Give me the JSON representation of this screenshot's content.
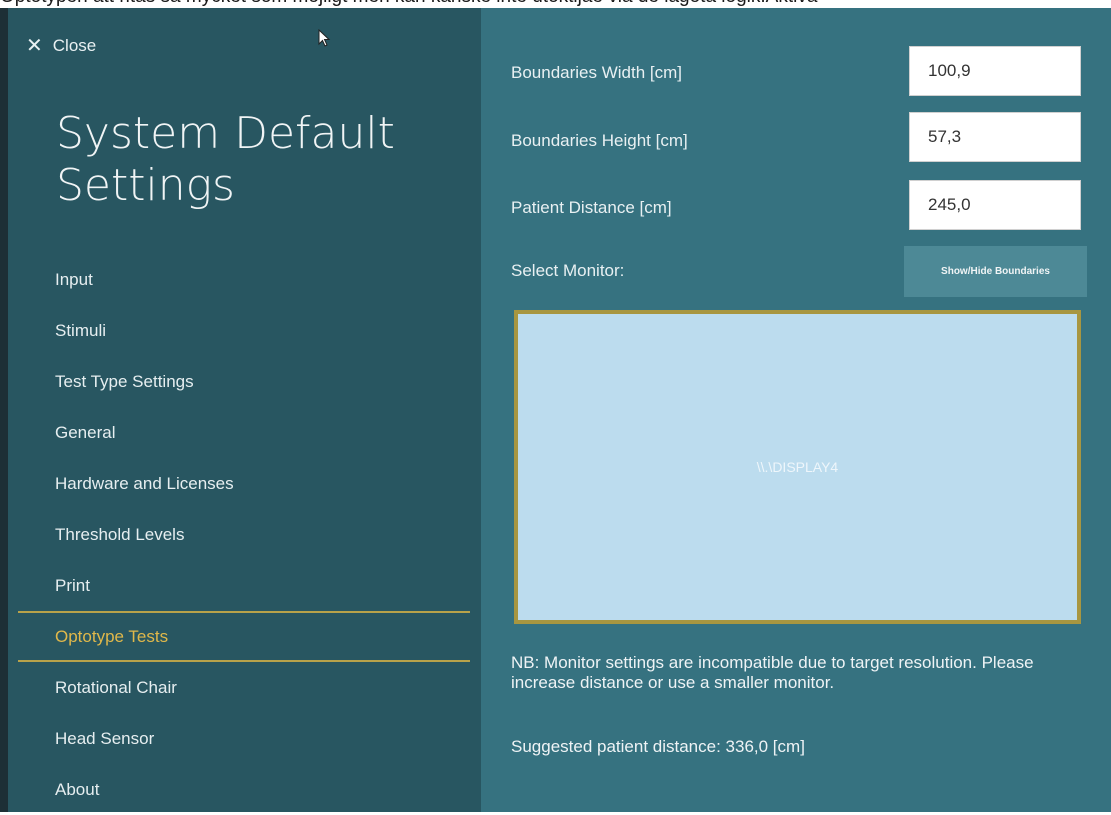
{
  "top_caption": "Optotypen att ritas så mycket som möjligt men kan kanske inte utöktijae via de lagota logik.Aktiva",
  "sidebar": {
    "close_label": "Close",
    "title": "System Default Settings",
    "items": [
      {
        "label": "Input",
        "active": false
      },
      {
        "label": "Stimuli",
        "active": false
      },
      {
        "label": "Test Type Settings",
        "active": false
      },
      {
        "label": "General",
        "active": false
      },
      {
        "label": "Hardware and Licenses",
        "active": false
      },
      {
        "label": "Threshold Levels",
        "active": false
      },
      {
        "label": "Print",
        "active": false
      },
      {
        "label": "Optotype Tests",
        "active": true
      },
      {
        "label": "Rotational Chair",
        "active": false
      },
      {
        "label": "Head Sensor",
        "active": false
      },
      {
        "label": "About",
        "active": false
      }
    ]
  },
  "main": {
    "fields": [
      {
        "label": "Boundaries Width  [cm]",
        "value": "100,9"
      },
      {
        "label": "Boundaries Height  [cm]",
        "value": "57,3"
      },
      {
        "label": "Patient Distance  [cm]",
        "value": "245,0"
      }
    ],
    "select_monitor_label": "Select Monitor:",
    "toggle_button_label": "Show/Hide Boundaries",
    "monitor_name": "\\\\.\\DISPLAY4",
    "warning_text": "NB: Monitor settings are incompatible due to target resolution. Please increase distance or use a smaller monitor.",
    "suggested_text": "Suggested patient distance: 336,0 [cm]"
  },
  "icons": {
    "close": "close-icon",
    "cursor": "mouse-cursor-icon"
  },
  "colors": {
    "sidebar_bg": "#285661",
    "main_bg": "#367280",
    "accent": "#e0b84a",
    "monitor_bg": "#bcdcee",
    "monitor_border": "#a89640"
  }
}
